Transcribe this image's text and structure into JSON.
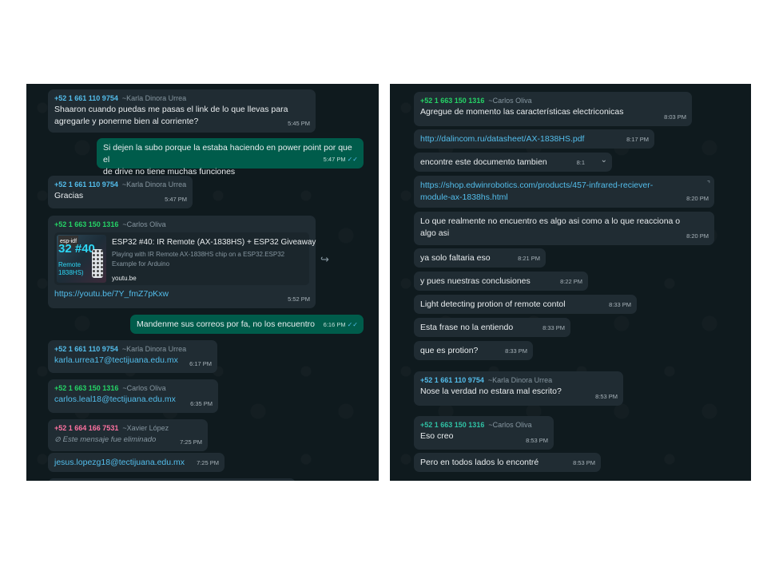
{
  "left": {
    "messages": [
      {
        "num": "+52 1 661 110 9754",
        "alias": "~Karla Dinora Urrea",
        "text": "Shaaron cuando puedas me pasas el link de lo que llevas para\nagregarle y ponerme bien al corriente?",
        "time": "5:45 PM"
      },
      {
        "text": "Si dejen la subo porque la estaba haciendo en power point por que el\nde drive no tiene muchas funciones",
        "time": "5:47 PM"
      },
      {
        "num": "+52 1 661 110 9754",
        "alias": "~Karla Dinora Urrea",
        "text": "Gracias",
        "time": "5:47 PM"
      },
      {
        "num": "+52 1 663 150 1316",
        "alias": "~Carlos Oliva",
        "preview": {
          "title": "ESP32 #40: IR Remote (AX-1838HS) + ESP32 Giveaway",
          "desc": "Playing with IR Remote AX-1838HS chip on a ESP32.ESP32\nExample for Arduino",
          "domain": "youtu.be",
          "thumb_tag": "esp-idf",
          "thumb_big": "32 #40",
          "thumb_l1": "Remote",
          "thumb_l2": "1838HS)"
        },
        "text": "https://youtu.be/7Y_fmZ7pKxw",
        "time": "5:52 PM"
      },
      {
        "text": "Mandenme sus correos por fa, no los encuentro",
        "time": "6:16 PM"
      },
      {
        "num": "+52 1 661 110 9754",
        "alias": "~Karla Dinora Urrea",
        "text": "karla.urrea17@tectijuana.edu.mx",
        "time": "6:17 PM"
      },
      {
        "num": "+52 1 663 150 1316",
        "alias": "~Carlos Oliva",
        "text": "carlos.leal18@tectijuana.edu.mx",
        "time": "6:35 PM"
      },
      {
        "num": "+52 1 664 166 7531",
        "alias": "~Xavier López",
        "deleted": "Este mensaje fue eliminado",
        "time": "7:25 PM"
      },
      {
        "text": "jesus.lopezg18@tectijuana.edu.mx",
        "time": "7:25 PM"
      }
    ]
  },
  "right": {
    "messages": [
      {
        "num": "+52 1 663 150 1316",
        "alias": "~Carlos Oliva",
        "text": "Agregue de momento las características electriconicas",
        "time": "8:03 PM"
      },
      {
        "text": "http://dalincom.ru/datasheet/AX-1838HS.pdf",
        "time": "8:17 PM"
      },
      {
        "text": "encontre este documento tambien",
        "time": "8:1"
      },
      {
        "text": "https://shop.edwinrobotics.com/products/457-infrared-reciever-\nmodule-ax-1838hs.html",
        "time": "8:20 PM"
      },
      {
        "text": "Lo que realmente no encuentro es algo asi como a lo que reacciona o\nalgo asi",
        "time": "8:20 PM"
      },
      {
        "text": "ya solo faltaria eso",
        "time": "8:21 PM"
      },
      {
        "text": "y pues nuestras conclusiones",
        "time": "8:22 PM"
      },
      {
        "text": "Light detecting protion of remote contol",
        "time": "8:33 PM"
      },
      {
        "text": "Esta frase no la entiendo",
        "time": "8:33 PM"
      },
      {
        "text": "que es protion?",
        "time": "8:33 PM"
      },
      {
        "num": "+52 1 661 110 9754",
        "alias": "~Karla Dinora Urrea",
        "text": "Nose la verdad no estara mal escrito?",
        "time": "8:53 PM"
      },
      {
        "num": "+52 1 663 150 1316",
        "alias": "~Carlos Oliva",
        "text": "Eso creo",
        "time": "8:53 PM"
      },
      {
        "text": "Pero en todos lados lo encontré",
        "time": "8:53 PM"
      }
    ]
  },
  "icons": {
    "read_ticks": "✓✓",
    "forward": "↪",
    "chevron": "chevron-down",
    "deleted": "⃠"
  },
  "colors": {
    "panel_bg": "#0f1a1e",
    "incoming": "#202c33",
    "outgoing": "#005c4b",
    "link": "#53bdeb"
  }
}
